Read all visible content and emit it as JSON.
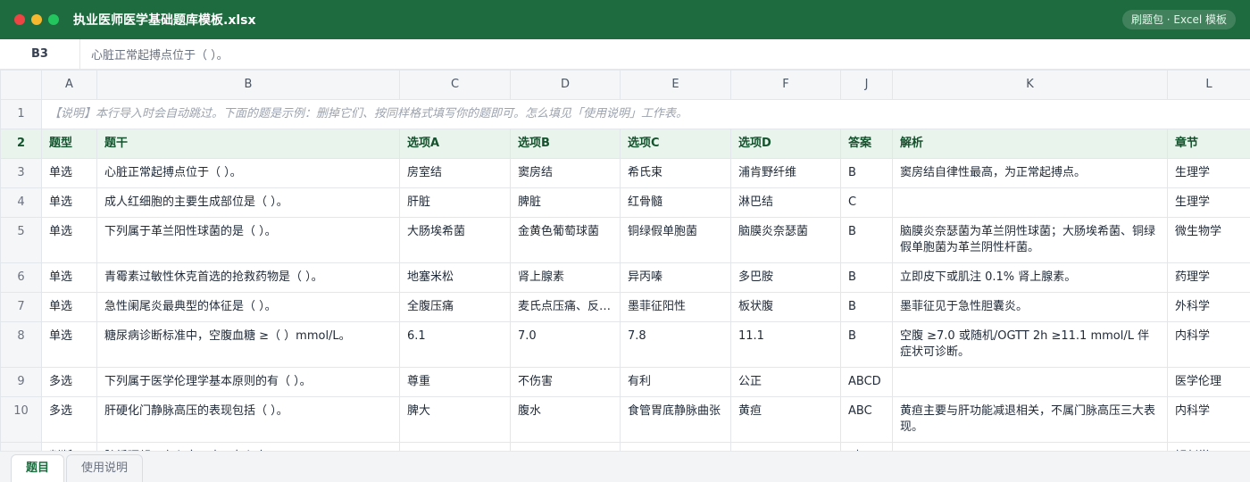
{
  "window": {
    "title": "执业医师医学基础题库模板.xlsx",
    "badge": "刷题包 · Excel 模板"
  },
  "formula_bar": {
    "cell_ref": "B3",
    "value": "心脏正常起搏点位于（ ）。"
  },
  "columns": [
    "A",
    "B",
    "C",
    "D",
    "E",
    "F",
    "J",
    "K",
    "L"
  ],
  "note_row": {
    "num": "1",
    "text": "【说明】本行导入时会自动跳过。下面的题是示例：删掉它们、按同样格式填写你的题即可。怎么填见「使用说明」工作表。"
  },
  "header_row": {
    "num": "2",
    "cells": [
      "题型",
      "题干",
      "选项A",
      "选项B",
      "选项C",
      "选项D",
      "答案",
      "解析",
      "章节"
    ]
  },
  "rows": [
    {
      "num": "3",
      "cells": [
        "单选",
        "心脏正常起搏点位于（ ）。",
        "房室结",
        "窦房结",
        "希氏束",
        "浦肯野纤维",
        "B",
        "窦房结自律性最高，为正常起搏点。",
        "生理学"
      ]
    },
    {
      "num": "4",
      "cells": [
        "单选",
        "成人红细胞的主要生成部位是（ ）。",
        "肝脏",
        "脾脏",
        "红骨髓",
        "淋巴结",
        "C",
        "",
        "生理学"
      ]
    },
    {
      "num": "5",
      "cells": [
        "单选",
        "下列属于革兰阳性球菌的是（ ）。",
        "大肠埃希菌",
        "金黄色葡萄球菌",
        "铜绿假单胞菌",
        "脑膜炎奈瑟菌",
        "B",
        "脑膜炎奈瑟菌为革兰阴性球菌；大肠埃希菌、铜绿假单胞菌为革兰阴性杆菌。",
        "微生物学"
      ]
    },
    {
      "num": "6",
      "cells": [
        "单选",
        "青霉素过敏性休克首选的抢救药物是（ ）。",
        "地塞米松",
        "肾上腺素",
        "异丙嗪",
        "多巴胺",
        "B",
        "立即皮下或肌注 0.1% 肾上腺素。",
        "药理学"
      ]
    },
    {
      "num": "7",
      "cells": [
        "单选",
        "急性阑尾炎最典型的体征是（ ）。",
        "全腹压痛",
        "麦氏点压痛、反…",
        "墨菲征阳性",
        "板状腹",
        "B",
        "墨菲征见于急性胆囊炎。",
        "外科学"
      ]
    },
    {
      "num": "8",
      "cells": [
        "单选",
        "糖尿病诊断标准中，空腹血糖 ≥（ ）mmol/L。",
        "6.1",
        "7.0",
        "7.8",
        "11.1",
        "B",
        "空腹 ≥7.0 或随机/OGTT 2h ≥11.1 mmol/L 伴症状可诊断。",
        "内科学"
      ]
    },
    {
      "num": "9",
      "cells": [
        "多选",
        "下列属于医学伦理学基本原则的有（ ）。",
        "尊重",
        "不伤害",
        "有利",
        "公正",
        "ABCD",
        "",
        "医学伦理"
      ]
    },
    {
      "num": "10",
      "cells": [
        "多选",
        "肝硬化门静脉高压的表现包括（ ）。",
        "脾大",
        "腹水",
        "食管胃底静脉曲张",
        "黄疸",
        "ABC",
        "黄疸主要与肝功能减退相关，不属门脉高压三大表现。",
        "内科学"
      ]
    },
    {
      "num": "11",
      "cells": [
        "判断",
        "肺循环起于右心室，止于左心房。",
        "",
        "",
        "",
        "",
        "对",
        "",
        "解剖学"
      ]
    }
  ],
  "sheet_tabs": [
    "题目",
    "使用说明"
  ],
  "colors": {
    "titlebar": "#1d6b3f",
    "header_row_bg": "#e8f4ec",
    "header_row_text": "#14532d"
  }
}
